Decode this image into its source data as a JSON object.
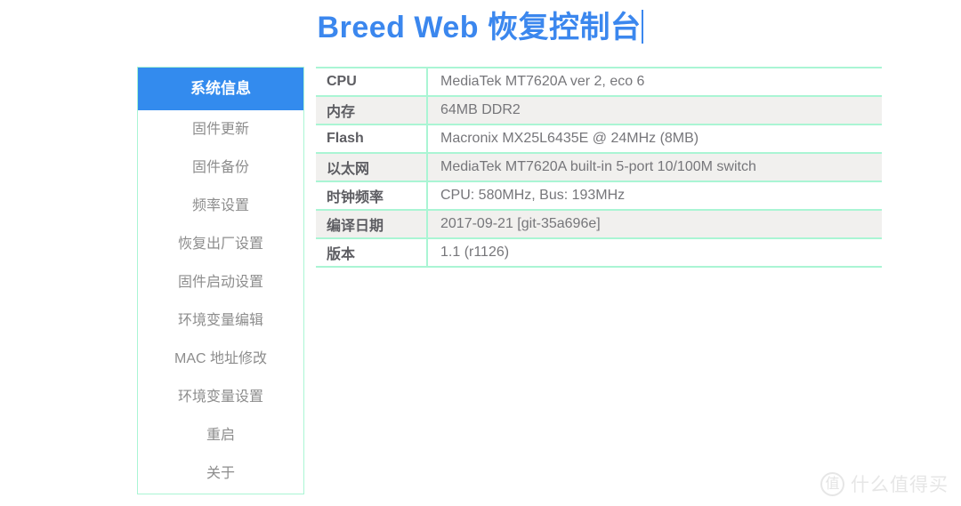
{
  "header": {
    "title": "Breed Web 恢复控制台",
    "caret_visible": true,
    "title_color": "#3b87ee"
  },
  "sidebar": {
    "active_index": 0,
    "active_bg": "#338bee",
    "border_color": "#aaf5d4",
    "items": [
      {
        "label": "系统信息",
        "active": true
      },
      {
        "label": "固件更新",
        "active": false
      },
      {
        "label": "固件备份",
        "active": false
      },
      {
        "label": "频率设置",
        "active": false
      },
      {
        "label": "恢复出厂设置",
        "active": false
      },
      {
        "label": "固件启动设置",
        "active": false
      },
      {
        "label": "环境变量编辑",
        "active": false
      },
      {
        "label": "MAC 地址修改",
        "active": false
      },
      {
        "label": "环境变量设置",
        "active": false
      },
      {
        "label": "重启",
        "active": false
      },
      {
        "label": "关于",
        "active": false
      }
    ]
  },
  "main": {
    "table": {
      "border_color": "#aaf5d4",
      "stripe_color": "#f1f0ee",
      "rows": [
        {
          "label": "CPU",
          "value": "MediaTek MT7620A ver 2, eco 6"
        },
        {
          "label": "内存",
          "value": "64MB DDR2"
        },
        {
          "label": "Flash",
          "value": "Macronix MX25L6435E @ 24MHz (8MB)"
        },
        {
          "label": "以太网",
          "value": "MediaTek MT7620A built-in 5-port 10/100M switch"
        },
        {
          "label": "时钟频率",
          "value": "CPU: 580MHz, Bus: 193MHz"
        },
        {
          "label": "编译日期",
          "value": "2017-09-21 [git-35a696e]"
        },
        {
          "label": "版本",
          "value": "1.1 (r1126)"
        }
      ]
    }
  },
  "watermark": {
    "logo_char": "值",
    "text": "什么值得买",
    "color": "#e6e6e6"
  }
}
